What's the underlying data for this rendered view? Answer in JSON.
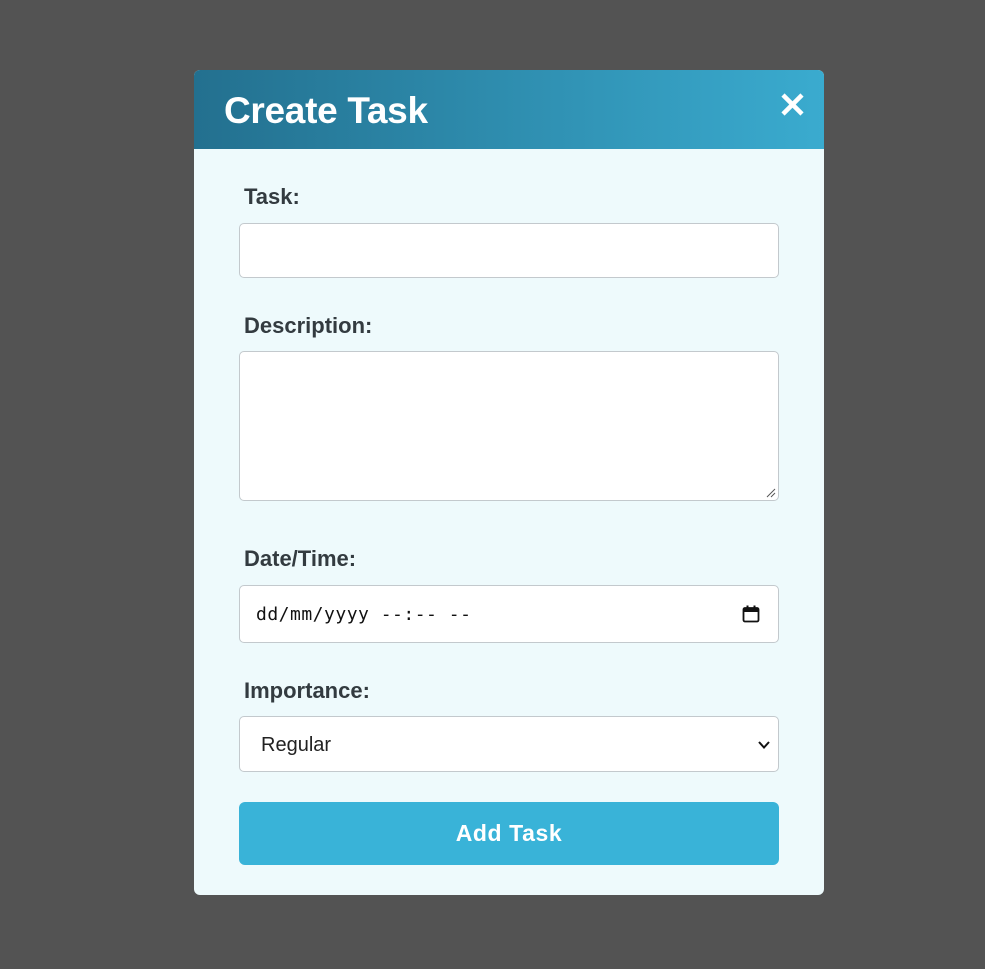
{
  "modal": {
    "title": "Create Task",
    "close_icon": "close-icon"
  },
  "form": {
    "task_label": "Task:",
    "task_value": "",
    "description_label": "Description:",
    "description_value": "",
    "datetime_label": "Date/Time:",
    "datetime_placeholder": "dd/mm/yyyy --:-- --",
    "importance_label": "Importance:",
    "importance_selected": "Regular",
    "submit_label": "Add Task"
  },
  "icons": {
    "close": "close-icon",
    "calendar": "calendar-icon",
    "chevron": "chevron-down-icon",
    "resize": "resize-grip-icon"
  },
  "colors": {
    "backdrop": "#535353",
    "header_start": "#23708f",
    "header_end": "#3aabcf",
    "panel": "#eefafc",
    "button": "#39b3d8"
  }
}
